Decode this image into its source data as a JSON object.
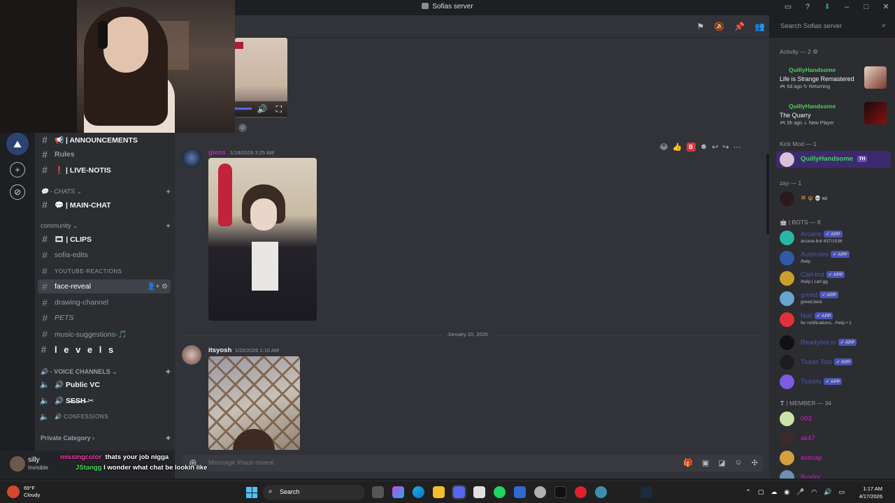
{
  "window": {
    "title": "Sofias server",
    "controls": [
      "▭",
      "?",
      "⬇",
      "–",
      "□",
      "✕"
    ]
  },
  "header": {
    "search_placeholder": "Search Sofias server",
    "icons": [
      "threads-icon",
      "mute-icon",
      "pin-icon",
      "members-icon"
    ]
  },
  "sidebar": {
    "items": [
      {
        "label": "📢 | ANNOUNCEMENTS",
        "style": "bold"
      },
      {
        "label": "Rules",
        "style": "bold"
      },
      {
        "label": "❗ | LIVE-NOTIS",
        "style": "bold"
      },
      {
        "label": "💬 - CHATS ⌄",
        "style": "category"
      },
      {
        "label": "💬 | MAIN-CHAT",
        "style": "bold"
      },
      {
        "label": "community ⌄",
        "style": "category"
      },
      {
        "label": "🎞 | CLIPS",
        "style": "bold"
      },
      {
        "label": "sofia-edits",
        "style": "normal"
      },
      {
        "label": "YOUTUBE-REACTIONS",
        "style": "upper"
      },
      {
        "label": "face-reveal",
        "style": "active"
      },
      {
        "label": "drawing-channel",
        "style": "normal"
      },
      {
        "label": "PETS",
        "style": "normal"
      },
      {
        "label": "music-suggestions-🎵",
        "style": "normal"
      },
      {
        "label": "l e v e l s",
        "style": "spaced"
      },
      {
        "label": "🔊 - VOICE CHANNELS ⌄",
        "style": "category"
      },
      {
        "label": "🔊 Public VC",
        "style": "bold"
      },
      {
        "label": "🔊 S̶E̶S̶H̶ ✂",
        "style": "bold"
      },
      {
        "label": "🔊 CONFESSIONS",
        "style": "upper"
      },
      {
        "label": "Private Category ›",
        "style": "category"
      }
    ]
  },
  "user_panel": {
    "name": "silly",
    "status": "Invisible"
  },
  "messages": [
    {
      "author": "gloss",
      "time": "1/18/2026 3:25 AM",
      "color": "#d916d1"
    },
    {
      "date_divider": "January 20, 2026"
    },
    {
      "author": "itsyosh",
      "time": "1/20/2026 1:16 AM",
      "color": "#f2f3f5"
    }
  ],
  "composer": {
    "placeholder": "Message #face-reveal"
  },
  "members": {
    "activity_header": "Activity — 2 ⚙",
    "activities": [
      {
        "user": "QuillyHandsome",
        "game": "Life is Strange Remastered",
        "sub": "🎮 6d ago  ↻ Returning"
      },
      {
        "user": "QuillyHandsome",
        "game": "The Quarry",
        "sub": "🎮 5h ago  ⇣ New Player"
      }
    ],
    "kickmod_header": "Kick Mod — 1",
    "kickmod_name": "QuillyHandsome",
    "kickmod_tag": "TH",
    "zay_header": "zay — 1",
    "zay_name": "≋ ψ",
    "zay_tag": "💀 xo",
    "bots_header": "🤖 | BOTS — 8",
    "bots": [
      {
        "name": "Arcane",
        "sub": "arcane.bot 437/1536",
        "color": "#2bb5a5"
      },
      {
        "name": "Autoroles",
        "sub": "/help",
        "color": "#2e5aa8"
      },
      {
        "name": "Carl-bot",
        "sub": "/help | carl.gg",
        "color": "#c8a02a"
      },
      {
        "name": "greed",
        "sub": "greed.best",
        "color": "#6aa5d1"
      },
      {
        "name": "Noti",
        "sub": "for notifications.. /help • 1",
        "color": "#e0323a"
      },
      {
        "name": "Readybot.io",
        "sub": "",
        "color": "#111111"
      },
      {
        "name": "Ticket Tool",
        "sub": "",
        "color": "#1d1d1d"
      },
      {
        "name": "Tickets",
        "sub": "",
        "color": "#7c5ce0"
      }
    ],
    "app_badge": "✔ APP",
    "member_header": "❣ | MEMBER — 34",
    "people": [
      {
        "name": "003",
        "color": "#c9e3a8"
      },
      {
        "name": "ak47",
        "color": "#3d2a2a"
      },
      {
        "name": "axecap",
        "color": "#d4a040"
      },
      {
        "name": "Brodor",
        "color": "#6e8fb2"
      }
    ]
  },
  "stream_chat": [
    {
      "user": "missingcolor",
      "text": "thats your job nigga"
    },
    {
      "user": "JStangg",
      "text": "I wonder what chat be lookin like"
    }
  ],
  "taskbar": {
    "weather_temp": "69°F",
    "weather_desc": "Cloudy",
    "search_label": "Search",
    "time": "1:17 AM",
    "date": "4/17/2026"
  }
}
